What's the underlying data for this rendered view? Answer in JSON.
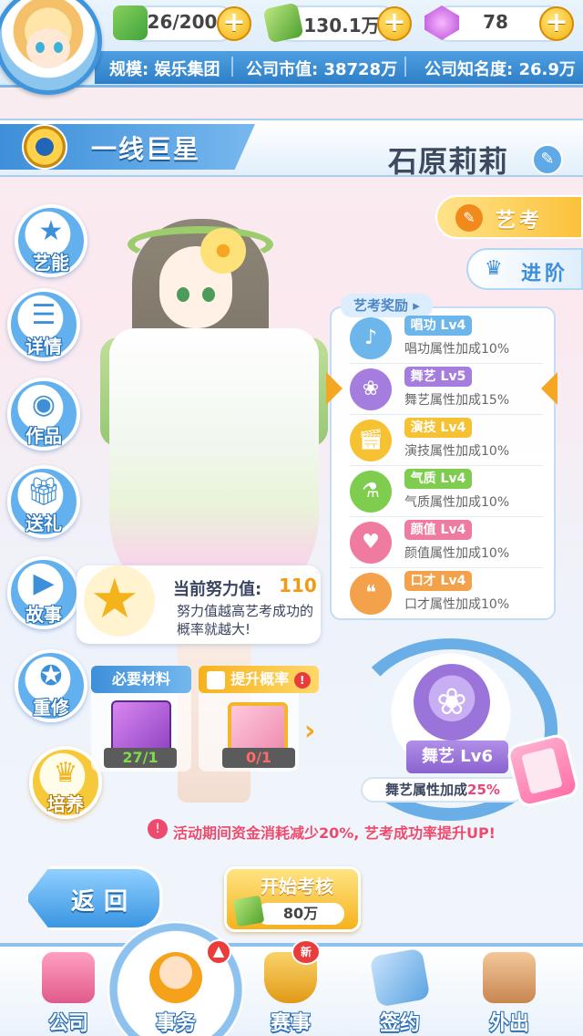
{
  "resources": {
    "energy": "26/200",
    "money": "130.1万",
    "gems": "78"
  },
  "stats": {
    "scale": "规模: 娱乐集团",
    "market_value": "公司市值: 38728万",
    "fame": "公司知名度: 26.9万"
  },
  "header": {
    "rank_title": "一线巨星",
    "character_name": "石原莉莉"
  },
  "side_menu": [
    {
      "label": "艺能",
      "icon": "star-icon"
    },
    {
      "label": "详情",
      "icon": "list-icon"
    },
    {
      "label": "作品",
      "icon": "disc-icon"
    },
    {
      "label": "送礼",
      "icon": "gift-icon"
    },
    {
      "label": "故事",
      "icon": "video-icon"
    },
    {
      "label": "重修",
      "icon": "refresh-star-icon"
    },
    {
      "label": "培养",
      "icon": "crown-icon"
    }
  ],
  "tabs": {
    "exam": "艺考",
    "advance": "进阶"
  },
  "rewards": {
    "title": "艺考奖励 ▸",
    "items": [
      {
        "tag": "唱功 Lv4",
        "desc": "唱功属性加成10%",
        "color": "#6cb6ec",
        "icon": "microphone-icon"
      },
      {
        "tag": "舞艺 Lv5",
        "desc": "舞艺属性加成15%",
        "color": "#a57ddf",
        "icon": "dance-icon"
      },
      {
        "tag": "演技 Lv4",
        "desc": "演技属性加成10%",
        "color": "#f6c232",
        "icon": "clapperboard-icon"
      },
      {
        "tag": "气质 Lv4",
        "desc": "气质属性加成10%",
        "color": "#7fcd4e",
        "icon": "potion-icon"
      },
      {
        "tag": "颜值 Lv4",
        "desc": "颜值属性加成10%",
        "color": "#ef7ca0",
        "icon": "lipstick-icon"
      },
      {
        "tag": "口才 Lv4",
        "desc": "口才属性加成10%",
        "color": "#f3a14a",
        "icon": "speech-icon"
      }
    ]
  },
  "effort": {
    "label": "当前努力值:",
    "value": "110",
    "desc": "努力值越高艺考成功的概率就越大!"
  },
  "materials": {
    "required_label": "必要材料",
    "required_count": "27/1",
    "boost_label": "提升概率",
    "boost_count": "0/1"
  },
  "emblem": {
    "ribbon": "舞艺 Lv6",
    "bonus_prefix": "舞艺属性加成",
    "bonus_pct": "25%"
  },
  "notice": "活动期间资金消耗减少20%, 艺考成功率提升UP!",
  "actions": {
    "back": "返回",
    "start": "开始考核",
    "cost": "80万"
  },
  "bottom_nav": [
    {
      "label": "公司",
      "icon": "company-building-icon"
    },
    {
      "label": "事务",
      "icon": "manager-icon"
    },
    {
      "label": "赛事",
      "icon": "trophy-icon"
    },
    {
      "label": "签约",
      "icon": "contract-icon"
    },
    {
      "label": "外出",
      "icon": "door-exit-icon"
    }
  ],
  "badges": {
    "nav_new": "新"
  }
}
